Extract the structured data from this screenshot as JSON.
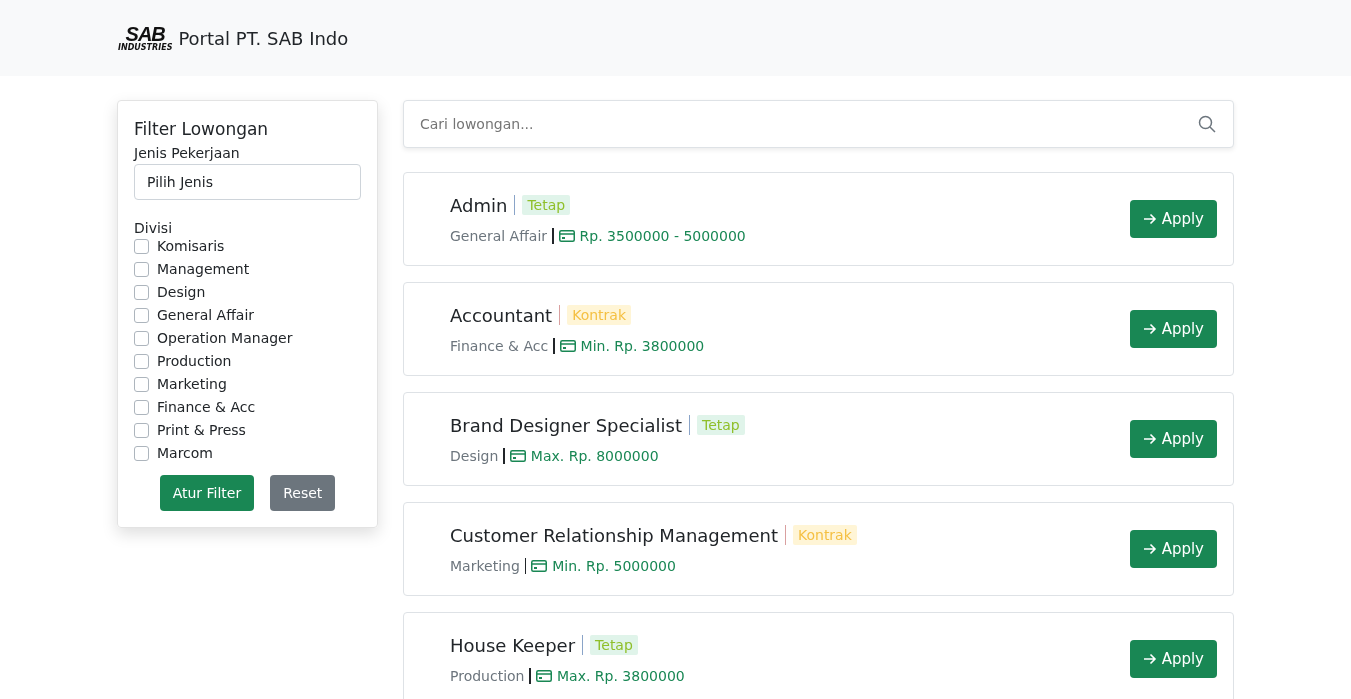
{
  "navbar": {
    "brand": "Portal PT. SAB Indo",
    "logo_text": "SAB",
    "logo_sub": "INDUSTRIES"
  },
  "filter": {
    "title": "Filter Lowongan",
    "job_type_label": "Jenis Pekerjaan",
    "job_type_value": "Pilih Jenis",
    "division_label": "Divisi",
    "divisions": [
      {
        "label": "Komisaris",
        "checked": false
      },
      {
        "label": "Management",
        "checked": false
      },
      {
        "label": "Design",
        "checked": false
      },
      {
        "label": "General Affair",
        "checked": false
      },
      {
        "label": "Operation Manager",
        "checked": false
      },
      {
        "label": "Production",
        "checked": false
      },
      {
        "label": "Marketing",
        "checked": false
      },
      {
        "label": "Finance & Acc",
        "checked": false
      },
      {
        "label": "Print & Press",
        "checked": false
      },
      {
        "label": "Marcom",
        "checked": false
      }
    ],
    "apply_button": "Atur Filter",
    "reset_button": "Reset"
  },
  "search": {
    "placeholder": "Cari lowongan..."
  },
  "jobs": [
    {
      "title": "Admin",
      "type": "Tetap",
      "kind": "tetap",
      "division": "General Affair",
      "salary": "Rp. 3500000 - 5000000",
      "button": "Apply"
    },
    {
      "title": "Accountant",
      "type": "Kontrak",
      "kind": "kontrak",
      "division": "Finance & Acc",
      "salary": "Min. Rp. 3800000",
      "button": "Apply"
    },
    {
      "title": "Brand Designer Specialist",
      "type": "Tetap",
      "kind": "tetap",
      "division": "Design",
      "salary": "Max. Rp. 8000000",
      "button": "Apply"
    },
    {
      "title": "Customer Relationship Management",
      "type": "Kontrak",
      "kind": "kontrak",
      "division": "Marketing",
      "salary": "Min. Rp. 5000000",
      "button": "Apply"
    },
    {
      "title": "House Keeper",
      "type": "Tetap",
      "kind": "tetap",
      "division": "Production",
      "salary": "Max. Rp. 3800000",
      "button": "Apply"
    }
  ]
}
